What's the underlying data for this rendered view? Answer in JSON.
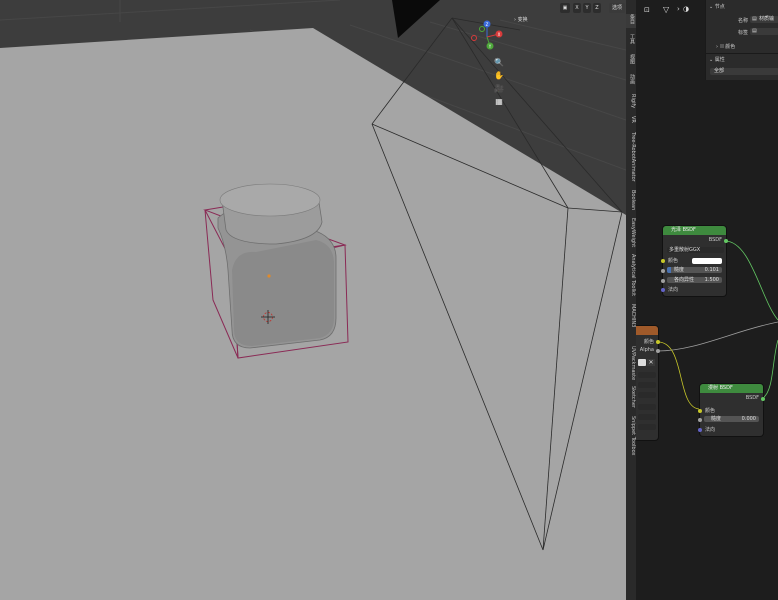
{
  "viewport": {
    "header": {
      "options_label": "选项",
      "xyz": [
        "X",
        "Y",
        "Z"
      ]
    },
    "sidebar_panel": {
      "transform_label": "变换"
    },
    "gizmo": {
      "x_label": "X",
      "y_label": "Y",
      "z_label": "Z"
    },
    "tabs": [
      "条目",
      "工具",
      "视图",
      "动画",
      "Rigify",
      "VR",
      "Tree-RobotAnimator",
      "Boolean",
      "EasyWeight",
      "Analytical Toolkit",
      "MACHIN3",
      "UVPackmaster",
      "Sketcher",
      "Snippet Toolbox"
    ]
  },
  "node_editor": {
    "properties_panel": {
      "node_section": "节点",
      "name_label": "名称",
      "name_value": "材质输",
      "label_label": "标签",
      "color_label": "颜色",
      "properties_section": "属性",
      "target_value": "全部"
    },
    "glossy_node": {
      "title": "光泽 BSDF",
      "output": "BSDF",
      "distribution": "多重散射GGX",
      "color_label": "颜色",
      "roughness_label": "糙度",
      "roughness_value": "0.101",
      "anisotropy_label": "各向异性",
      "anisotropy_value": "1.500",
      "normal_label": "法向"
    },
    "image_node": {
      "color_output": "颜色",
      "alpha_output": "Alpha"
    },
    "diffuse_node": {
      "title": "漫射 BSDF",
      "output": "BSDF",
      "color_label": "颜色",
      "roughness_label": "糙度",
      "roughness_value": "0.000",
      "normal_label": "法向"
    }
  }
}
